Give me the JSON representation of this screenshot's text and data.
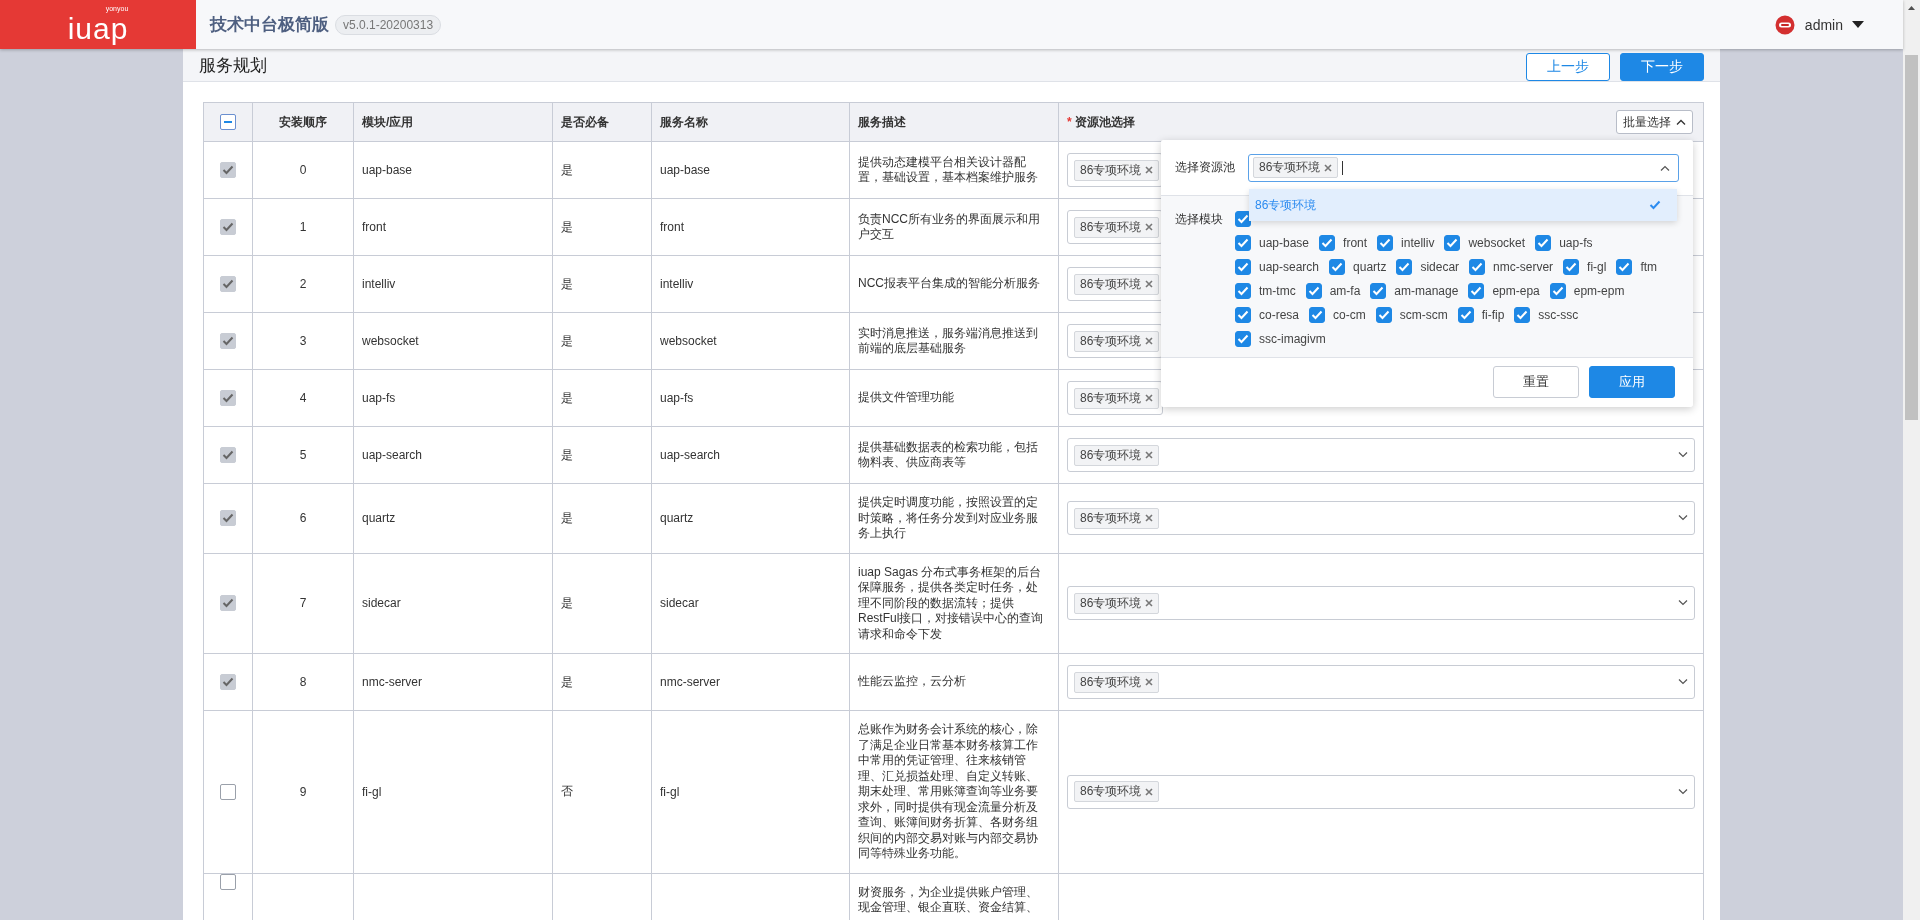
{
  "header": {
    "logo": "iuap",
    "logo_small": "yonyou",
    "title": "技术中台极简版",
    "version": "v5.0.1-20200313",
    "user": "admin"
  },
  "page": {
    "title": "服务规划",
    "buttons": [
      {
        "label": "上一步",
        "kind": "secondary"
      },
      {
        "label": "下一步",
        "kind": "primary"
      }
    ]
  },
  "table": {
    "select_all": {
      "indeterminate": true
    },
    "columns": [
      {
        "label": "安装顺序"
      },
      {
        "label": "模块/应用"
      },
      {
        "label": "是否必备"
      },
      {
        "label": "服务名称"
      },
      {
        "label": "服务描述"
      },
      {
        "label": "资源池选择",
        "mark": "*"
      }
    ],
    "batch_button": {
      "label": "批量选择",
      "expanded": true
    },
    "rows": [
      {
        "checked": true,
        "disabled": true,
        "order": "0",
        "module": "uap-base",
        "required": "是",
        "service": "uap-base",
        "description": "提供动态建模平台相关设计器配置，基础设置，基本档案维护服务",
        "pools": [
          "86专项环境"
        ],
        "covered": true
      },
      {
        "checked": true,
        "disabled": true,
        "order": "1",
        "module": "front",
        "required": "是",
        "service": "front",
        "description": "负责NCC所有业务的界面展示和用户交互",
        "pools": [
          "86专项环境"
        ],
        "covered": true
      },
      {
        "checked": true,
        "disabled": true,
        "order": "2",
        "module": "intelliv",
        "required": "是",
        "service": "intelliv",
        "description": "NCC报表平台集成的智能分析服务",
        "pools": [
          "86专项环境"
        ],
        "covered": true
      },
      {
        "checked": true,
        "disabled": true,
        "order": "3",
        "module": "websocket",
        "required": "是",
        "service": "websocket",
        "description": "实时消息推送，服务端消息推送到前端的底层基础服务",
        "pools": [
          "86专项环境"
        ],
        "covered": true
      },
      {
        "checked": true,
        "disabled": true,
        "order": "4",
        "module": "uap-fs",
        "required": "是",
        "service": "uap-fs",
        "description": "提供文件管理功能",
        "pools": [
          "86专项环境"
        ],
        "covered": true
      },
      {
        "checked": true,
        "disabled": true,
        "order": "5",
        "module": "uap-search",
        "required": "是",
        "service": "uap-search",
        "description": "提供基础数据表的检索功能，包括物料表、供应商表等",
        "pools": [
          "86专项环境"
        ],
        "covered": false
      },
      {
        "checked": true,
        "disabled": true,
        "order": "6",
        "module": "quartz",
        "required": "是",
        "service": "quartz",
        "description": "提供定时调度功能，按照设置的定时策略，将任务分发到对应业务服务上执行",
        "pools": [
          "86专项环境"
        ],
        "covered": false
      },
      {
        "checked": true,
        "disabled": true,
        "order": "7",
        "module": "sidecar",
        "required": "是",
        "service": "sidecar",
        "description": "iuap Sagas 分布式事务框架的后台保障服务，提供各类定时任务，处理不同阶段的数据流转；提供RestFul接口，对接错误中心的查询请求和命令下发",
        "pools": [
          "86专项环境"
        ],
        "covered": false
      },
      {
        "checked": true,
        "disabled": true,
        "order": "8",
        "module": "nmc-server",
        "required": "是",
        "service": "nmc-server",
        "description": "性能云监控，云分析",
        "pools": [
          "86专项环境"
        ],
        "covered": false
      },
      {
        "checked": false,
        "disabled": false,
        "order": "9",
        "module": "fi-gl",
        "required": "否",
        "service": "fi-gl",
        "description": "总账作为财务会计系统的核心，除了满足企业日常基本财务核算工作中常用的凭证管理、往来核销管理、汇兑损益处理、自定义转账、期末处理、常用账簿查询等业务要求外，同时提供有现金流量分析及查询、账簿间财务折算、各财务组织间的内部交易对账与内部交易协同等特殊业务功能。",
        "pools": [
          "86专项环境"
        ],
        "covered": false
      },
      {
        "checked": false,
        "disabled": false,
        "description": "财资服务，为企业提供账户管理、现金管理、银企直联、资金结算、"
      }
    ]
  },
  "popup": {
    "pool_label": "选择资源池",
    "pool_tags": [
      "86专项环境"
    ],
    "options": [
      {
        "label": "86专项环境",
        "selected": true
      }
    ],
    "module_label": "选择模块",
    "module_rows": [
      [
        {
          "checked": true
        }
      ],
      [
        {
          "label": "uap-base",
          "checked": true
        },
        {
          "label": "front",
          "checked": true
        },
        {
          "label": "intelliv",
          "checked": true
        },
        {
          "label": "websocket",
          "checked": true
        },
        {
          "label": "uap-fs",
          "checked": true
        }
      ],
      [
        {
          "label": "uap-search",
          "checked": true
        },
        {
          "label": "quartz",
          "checked": true
        },
        {
          "label": "sidecar",
          "checked": true
        },
        {
          "label": "nmc-server",
          "checked": true
        },
        {
          "label": "fi-gl",
          "checked": true
        },
        {
          "label": "ftm",
          "checked": true
        }
      ],
      [
        {
          "label": "tm-tmc",
          "checked": true
        },
        {
          "label": "am-fa",
          "checked": true
        },
        {
          "label": "am-manage",
          "checked": true
        },
        {
          "label": "epm-epa",
          "checked": true
        },
        {
          "label": "epm-epm",
          "checked": true
        }
      ],
      [
        {
          "label": "co-resa",
          "checked": true
        },
        {
          "label": "co-cm",
          "checked": true
        },
        {
          "label": "scm-scm",
          "checked": true
        },
        {
          "label": "fi-fip",
          "checked": true
        },
        {
          "label": "ssc-ssc",
          "checked": true
        }
      ],
      [
        {
          "label": "ssc-imagivm",
          "checked": true
        }
      ]
    ],
    "buttons": [
      {
        "label": "重置",
        "kind": "secondary"
      },
      {
        "label": "应用",
        "kind": "primary"
      }
    ]
  }
}
